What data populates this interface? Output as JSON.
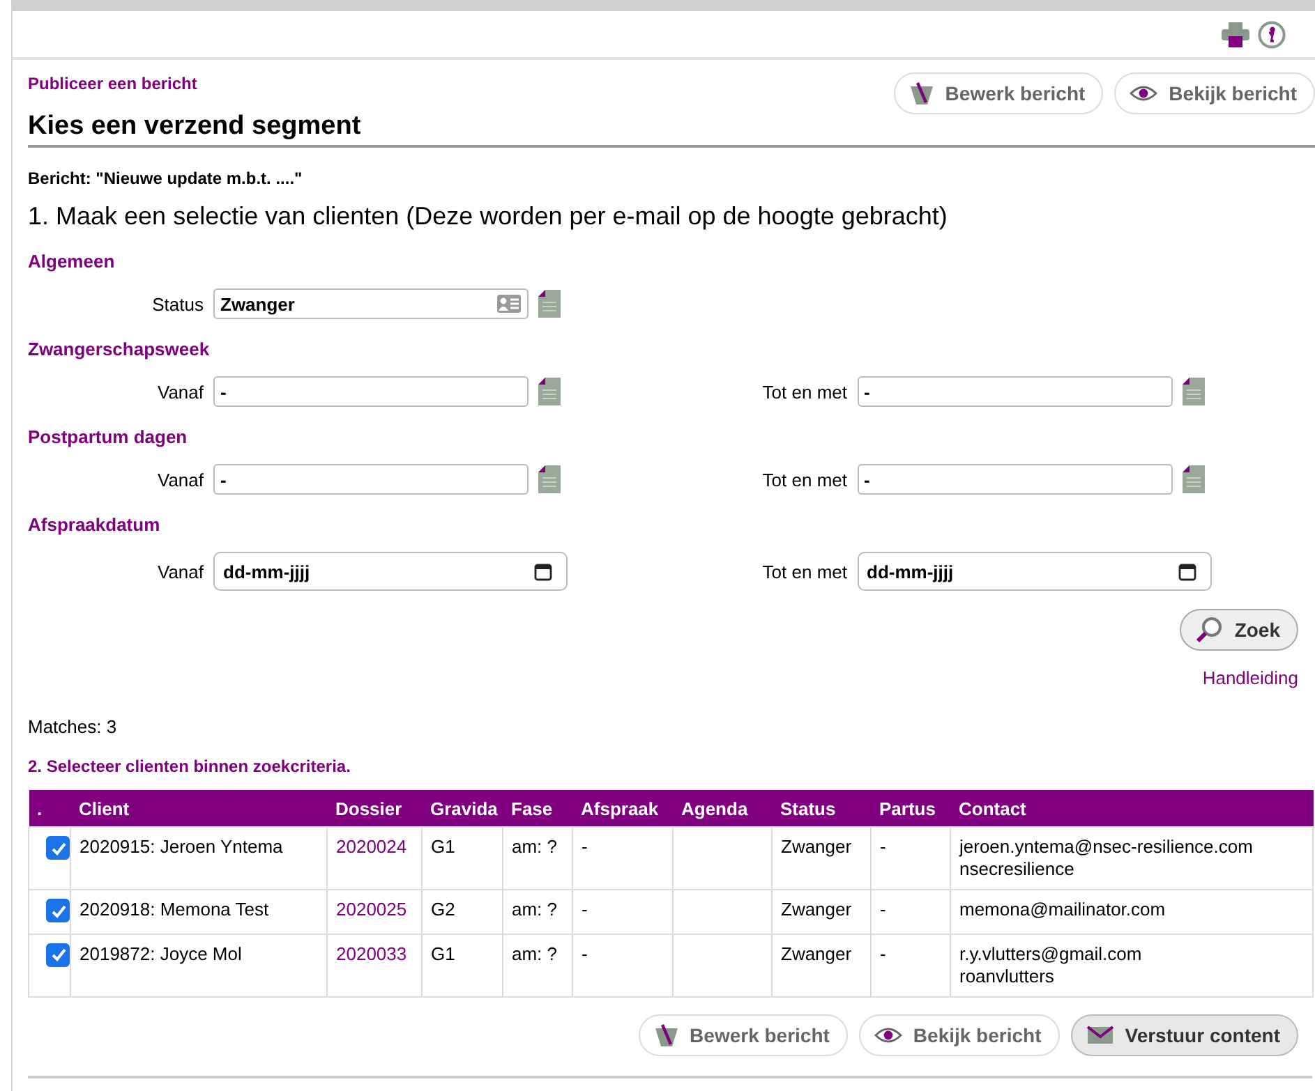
{
  "breadcrumb": "Publiceer een bericht",
  "top_buttons": [
    {
      "label": "Bewerk bericht",
      "kind": "edit",
      "emphasized": false
    },
    {
      "label": "Bekijk bericht",
      "kind": "view",
      "emphasized": false
    }
  ],
  "heading": "Kies een verzend segment",
  "message": "Bericht: \"Nieuwe update m.b.t. ....\"",
  "step1": "1. Maak een selectie van clienten (Deze worden per e-mail op de hoogte gebracht)",
  "sections": [
    {
      "title": "Algemeen",
      "fields": [
        {
          "label": "Status",
          "kind": "select",
          "value": "Zwanger"
        }
      ]
    },
    {
      "title": "Zwangerschapsweek",
      "fields": [
        {
          "label": "Vanaf",
          "kind": "text",
          "value": "-"
        },
        {
          "label": "Tot en met",
          "kind": "text",
          "value": "-"
        }
      ]
    },
    {
      "title": "Postpartum dagen",
      "fields": [
        {
          "label": "Vanaf",
          "kind": "text",
          "value": "-"
        },
        {
          "label": "Tot en met",
          "kind": "text",
          "value": "-"
        }
      ]
    },
    {
      "title": "Afspraakdatum",
      "fields": [
        {
          "label": "Vanaf",
          "kind": "date",
          "value": "dd-mm-jjjj"
        },
        {
          "label": "Tot en met",
          "kind": "date",
          "value": "dd-mm-jjjj"
        }
      ]
    }
  ],
  "search_button": "Zoek",
  "help_link": "Handleiding",
  "matches": "Matches: 3",
  "step2": "2. Selecteer clienten binnen zoekcriteria.",
  "table": {
    "columns": [
      ".",
      "Client",
      "Dossier",
      "Gravida",
      "Fase",
      "Afspraak",
      "Agenda",
      "Status",
      "Partus",
      "Contact"
    ],
    "rows": [
      {
        "checked": true,
        "client": "2020915: Jeroen Yntema",
        "dossier": "2020024",
        "gravida": "G1",
        "fase": "am: ?",
        "afspraak": "-",
        "status": "Zwanger",
        "partus": "-",
        "contact": [
          "jeroen.yntema@nsec-resilience.com",
          "nsecresilience"
        ]
      },
      {
        "checked": true,
        "client": "2020918: Memona Test",
        "dossier": "2020025",
        "gravida": "G2",
        "fase": "am: ?",
        "afspraak": "-",
        "status": "Zwanger",
        "partus": "-",
        "contact": [
          "memona@mailinator.com"
        ]
      },
      {
        "checked": true,
        "client": "2019872: Joyce Mol",
        "dossier": "2020033",
        "gravida": "G1",
        "fase": "am: ?",
        "afspraak": "-",
        "status": "Zwanger",
        "partus": "-",
        "contact": [
          "r.y.vlutters@gmail.com",
          "roanvlutters"
        ]
      }
    ]
  },
  "bottom_buttons": [
    {
      "label": "Bewerk bericht",
      "kind": "edit",
      "emphasized": false
    },
    {
      "label": "Bekijk bericht",
      "kind": "view",
      "emphasized": false
    },
    {
      "label": "Verstuur content",
      "kind": "send",
      "emphasized": true
    }
  ]
}
